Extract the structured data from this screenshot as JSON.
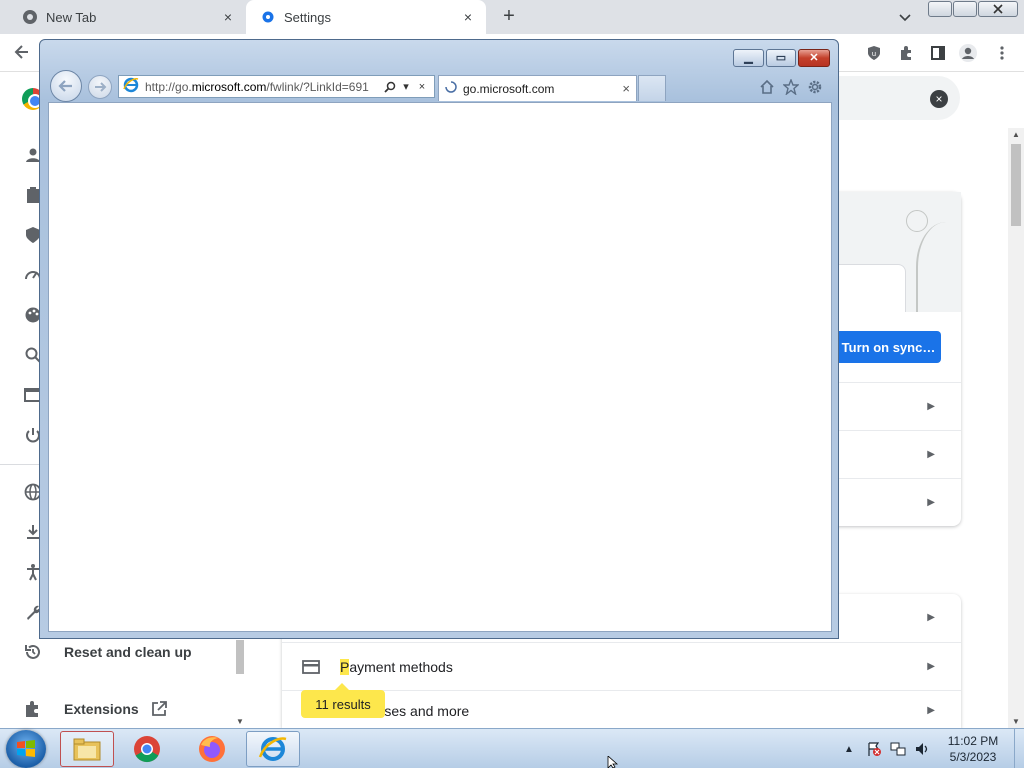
{
  "chrome": {
    "tabs": [
      {
        "title": "New Tab",
        "icon": "chrome-icon"
      },
      {
        "title": "Settings",
        "icon": "gear-icon"
      }
    ],
    "new_tab_label": "+",
    "close_glyph": "×"
  },
  "settings": {
    "sidebar_visible": [
      {
        "label": "Reset and clean up",
        "icon": "restore-icon"
      },
      {
        "label": "Extensions",
        "icon": "puzzle-icon"
      }
    ],
    "sync_button": "Turn on sync…",
    "rows": [
      {
        "label_hl": "P",
        "label_rest": "ayment methods",
        "icon": "card-icon"
      },
      {
        "label_hl": "",
        "label_rest": "Addresses and more",
        "icon": "pin-icon"
      }
    ],
    "results_badge": "11 results"
  },
  "ie": {
    "address_prefix": "http://go.",
    "address_domain": "microsoft.com",
    "address_suffix": "/fwlink/?LinkId=691",
    "tab_title": "go.microsoft.com",
    "close_glyph": "×"
  },
  "taskbar": {
    "time": "11:02 PM",
    "date": "5/3/2023",
    "apps": [
      "explorer",
      "chrome",
      "firefox",
      "internet-explorer"
    ]
  },
  "colors": {
    "chrome_blue": "#1a73e8",
    "highlight_yellow": "#fde74c",
    "ie_close_red": "#c4402b"
  }
}
